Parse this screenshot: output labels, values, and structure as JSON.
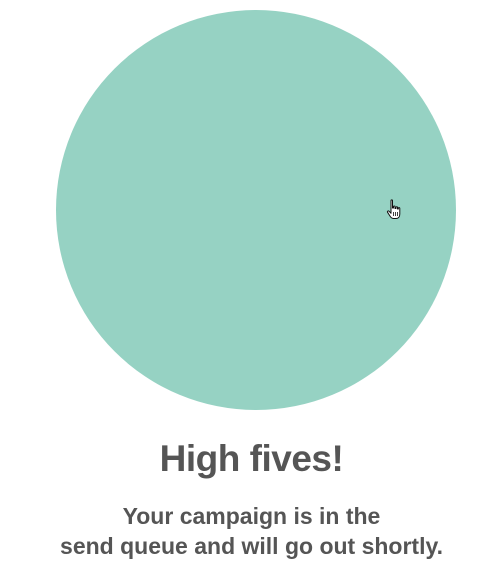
{
  "illustration": {
    "shape": "circle",
    "color": "#96d2c3"
  },
  "cursor": {
    "icon": "hand-pointer-icon"
  },
  "confirmation": {
    "title": "High fives!",
    "message_line1": "Your campaign is in the",
    "message_line2": "send queue and will go out shortly."
  },
  "colors": {
    "text": "#555555",
    "background": "#ffffff"
  }
}
